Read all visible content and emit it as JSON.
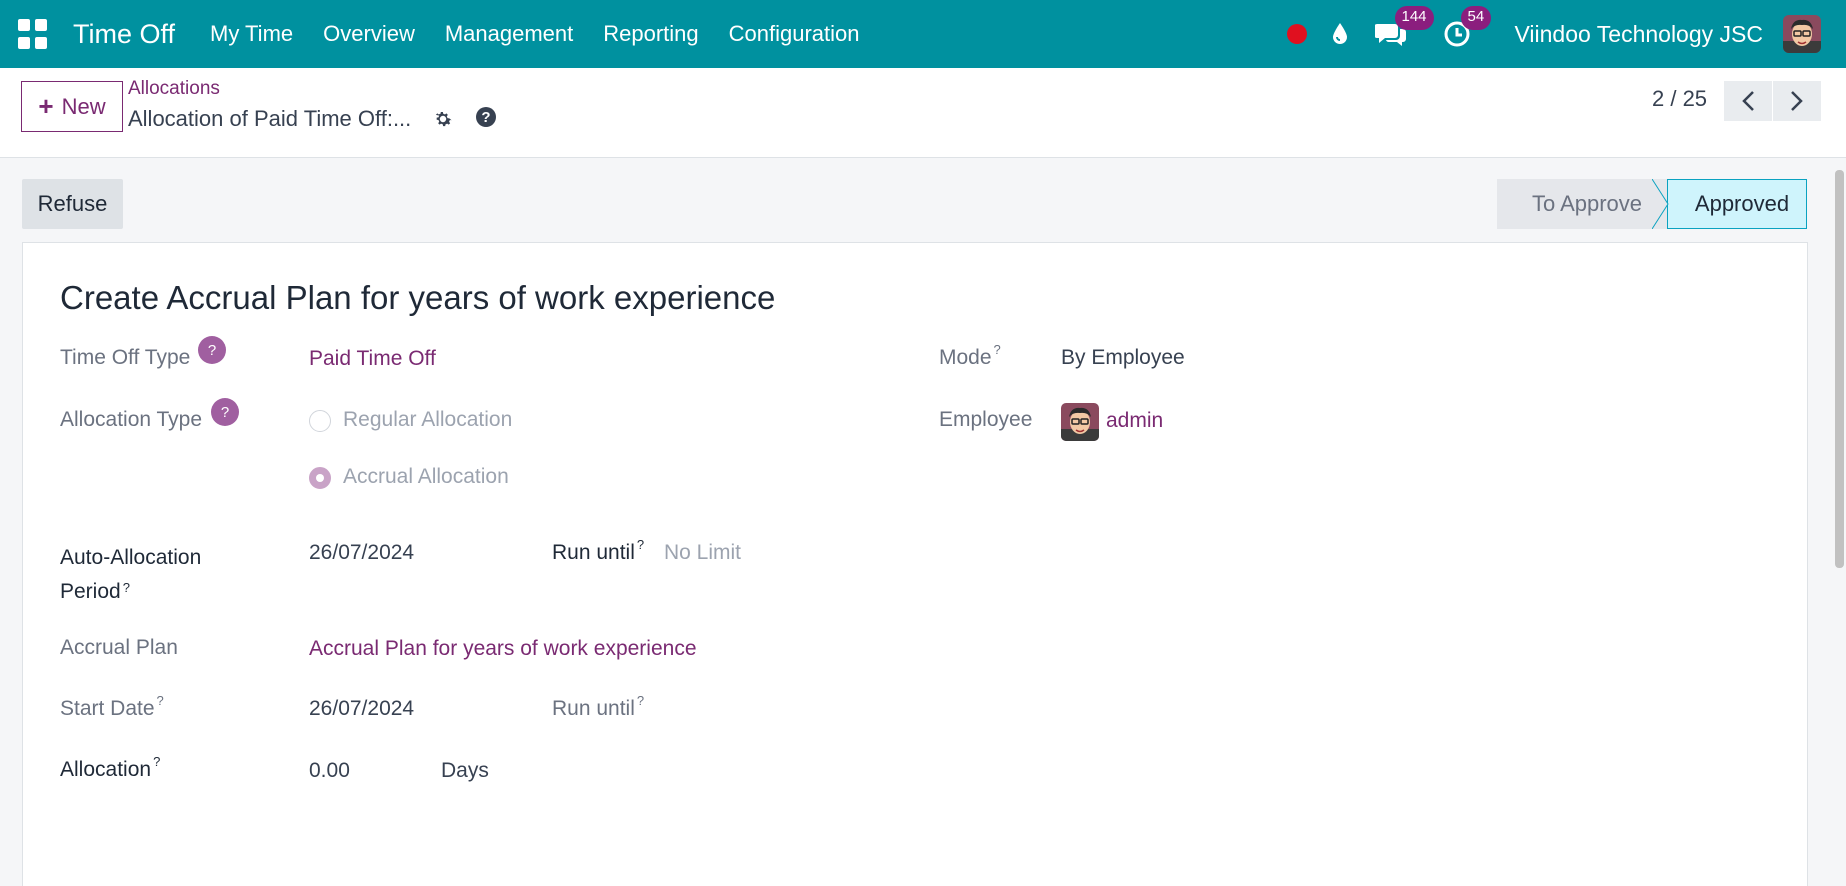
{
  "navbar": {
    "app_title": "Time Off",
    "menu": [
      "My Time",
      "Overview",
      "Management",
      "Reporting",
      "Configuration"
    ],
    "messages_count": "144",
    "activities_count": "54",
    "company": "Viindoo Technology JSC",
    "colors": {
      "bar": "#00919f",
      "badge": "#8b1e7e",
      "recording": "#e0101f"
    }
  },
  "control": {
    "new_label": "New",
    "breadcrumb": "Allocations",
    "record_title": "Allocation of Paid Time Off:...",
    "pager": "2 / 25"
  },
  "actions": {
    "refuse_label": "Refuse",
    "stages": [
      "To Approve",
      "Approved"
    ],
    "active_stage": "Approved"
  },
  "form": {
    "title": "Create Accrual Plan for years of work experience",
    "time_off_type_label": "Time Off Type",
    "time_off_type_value": "Paid Time Off",
    "allocation_type_label": "Allocation Type",
    "allocation_options": [
      "Regular Allocation",
      "Accrual Allocation"
    ],
    "allocation_selected": "Accrual Allocation",
    "mode_label": "Mode",
    "mode_value": "By Employee",
    "employee_label": "Employee",
    "employee_value": "admin",
    "auto_allocation_label_line1": "Auto-Allocation",
    "auto_allocation_label_line2": "Period",
    "auto_allocation_date": "26/07/2024",
    "run_until_label": "Run until",
    "run_until_placeholder": "No Limit",
    "accrual_plan_label": "Accrual Plan",
    "accrual_plan_value": "Accrual Plan for years of work experience",
    "start_date_label": "Start Date",
    "start_date_value": "26/07/2024",
    "run_until_label_2": "Run until",
    "allocation_label": "Allocation",
    "allocation_value": "0.00",
    "allocation_unit": "Days",
    "tooltip_mark": "?",
    "help_mark": "?"
  }
}
